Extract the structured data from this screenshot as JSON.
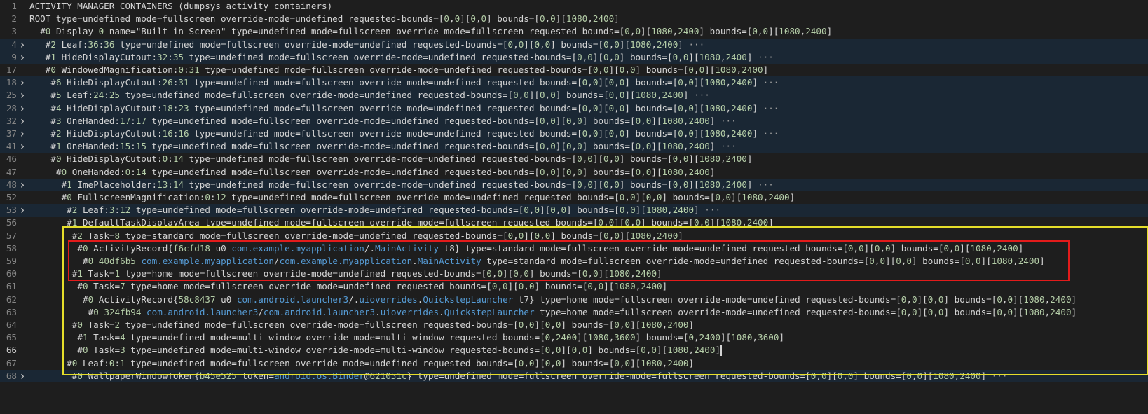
{
  "lines": [
    {
      "ln": "1",
      "fold": false,
      "indent": 0,
      "text": "ACTIVITY MANAGER CONTAINERS (dumpsys activity containers)"
    },
    {
      "ln": "2",
      "fold": false,
      "indent": 0,
      "text": "ROOT type=undefined mode=fullscreen override-mode=undefined requested-bounds=[0,0][0,0] bounds=[0,0][1080,2400]"
    },
    {
      "ln": "3",
      "fold": false,
      "indent": 2,
      "text": "#0 Display 0 name=\"Built-in Screen\" type=undefined mode=fullscreen override-mode=fullscreen requested-bounds=[0,0][1080,2400] bounds=[0,0][1080,2400]"
    },
    {
      "ln": "4",
      "fold": true,
      "indent": 3,
      "text": "#2 Leaf:36:36 type=undefined mode=fullscreen override-mode=undefined requested-bounds=[0,0][0,0] bounds=[0,0][1080,2400] ···"
    },
    {
      "ln": "9",
      "fold": true,
      "indent": 3,
      "text": "#1 HideDisplayCutout:32:35 type=undefined mode=fullscreen override-mode=undefined requested-bounds=[0,0][0,0] bounds=[0,0][1080,2400] ···"
    },
    {
      "ln": "17",
      "fold": false,
      "indent": 3,
      "text": "#0 WindowedMagnification:0:31 type=undefined mode=fullscreen override-mode=undefined requested-bounds=[0,0][0,0] bounds=[0,0][1080,2400]"
    },
    {
      "ln": "18",
      "fold": true,
      "indent": 4,
      "text": "#6 HideDisplayCutout:26:31 type=undefined mode=fullscreen override-mode=undefined requested-bounds=[0,0][0,0] bounds=[0,0][1080,2400] ···"
    },
    {
      "ln": "25",
      "fold": true,
      "indent": 4,
      "text": "#5 Leaf:24:25 type=undefined mode=fullscreen override-mode=undefined requested-bounds=[0,0][0,0] bounds=[0,0][1080,2400] ···"
    },
    {
      "ln": "28",
      "fold": true,
      "indent": 4,
      "text": "#4 HideDisplayCutout:18:23 type=undefined mode=fullscreen override-mode=undefined requested-bounds=[0,0][0,0] bounds=[0,0][1080,2400] ···"
    },
    {
      "ln": "32",
      "fold": true,
      "indent": 4,
      "text": "#3 OneHanded:17:17 type=undefined mode=fullscreen override-mode=undefined requested-bounds=[0,0][0,0] bounds=[0,0][1080,2400] ···"
    },
    {
      "ln": "37",
      "fold": true,
      "indent": 4,
      "text": "#2 HideDisplayCutout:16:16 type=undefined mode=fullscreen override-mode=undefined requested-bounds=[0,0][0,0] bounds=[0,0][1080,2400] ···"
    },
    {
      "ln": "41",
      "fold": true,
      "indent": 4,
      "text": "#1 OneHanded:15:15 type=undefined mode=fullscreen override-mode=undefined requested-bounds=[0,0][0,0] bounds=[0,0][1080,2400] ···"
    },
    {
      "ln": "46",
      "fold": false,
      "indent": 4,
      "text": "#0 HideDisplayCutout:0:14 type=undefined mode=fullscreen override-mode=undefined requested-bounds=[0,0][0,0] bounds=[0,0][1080,2400]"
    },
    {
      "ln": "47",
      "fold": false,
      "indent": 5,
      "text": "#0 OneHanded:0:14 type=undefined mode=fullscreen override-mode=undefined requested-bounds=[0,0][0,0] bounds=[0,0][1080,2400]"
    },
    {
      "ln": "48",
      "fold": true,
      "indent": 6,
      "text": "#1 ImePlaceholder:13:14 type=undefined mode=fullscreen override-mode=undefined requested-bounds=[0,0][0,0] bounds=[0,0][1080,2400] ···"
    },
    {
      "ln": "52",
      "fold": false,
      "indent": 6,
      "text": "#0 FullscreenMagnification:0:12 type=undefined mode=fullscreen override-mode=undefined requested-bounds=[0,0][0,0] bounds=[0,0][1080,2400]"
    },
    {
      "ln": "53",
      "fold": true,
      "indent": 7,
      "text": "#2 Leaf:3:12 type=undefined mode=fullscreen override-mode=undefined requested-bounds=[0,0][0,0] bounds=[0,0][1080,2400] ···"
    },
    {
      "ln": "56",
      "fold": false,
      "indent": 7,
      "text": "#1 DefaultTaskDisplayArea type=undefined mode=fullscreen override-mode=fullscreen requested-bounds=[0,0][0,0] bounds=[0,0][1080,2400]"
    },
    {
      "ln": "57",
      "fold": false,
      "indent": 8,
      "text": "#2 Task=8 type=standard mode=fullscreen override-mode=undefined requested-bounds=[0,0][0,0] bounds=[0,0][1080,2400]"
    },
    {
      "ln": "58",
      "fold": false,
      "indent": 9,
      "text": "#0 ActivityRecord{f6cfd18 u0 com.example.myapplication/.MainActivity t8} type=standard mode=fullscreen override-mode=undefined requested-bounds=[0,0][0,0] bounds=[0,0][1080,2400]"
    },
    {
      "ln": "59",
      "fold": false,
      "indent": 10,
      "text": "#0 40df6b5 com.example.myapplication/com.example.myapplication.MainActivity type=standard mode=fullscreen override-mode=undefined requested-bounds=[0,0][0,0] bounds=[0,0][1080,2400]"
    },
    {
      "ln": "60",
      "fold": false,
      "indent": 8,
      "text": "#1 Task=1 type=home mode=fullscreen override-mode=undefined requested-bounds=[0,0][0,0] bounds=[0,0][1080,2400]"
    },
    {
      "ln": "61",
      "fold": false,
      "indent": 9,
      "text": "#0 Task=7 type=home mode=fullscreen override-mode=undefined requested-bounds=[0,0][0,0] bounds=[0,0][1080,2400]"
    },
    {
      "ln": "62",
      "fold": false,
      "indent": 10,
      "text": "#0 ActivityRecord{58c8437 u0 com.android.launcher3/.uioverrides.QuickstepLauncher t7} type=home mode=fullscreen override-mode=undefined requested-bounds=[0,0][0,0] bounds=[0,0][1080,2400]"
    },
    {
      "ln": "63",
      "fold": false,
      "indent": 11,
      "text": "#0 324fb94 com.android.launcher3/com.android.launcher3.uioverrides.QuickstepLauncher type=home mode=fullscreen override-mode=undefined requested-bounds=[0,0][0,0] bounds=[0,0][1080,2400]"
    },
    {
      "ln": "64",
      "fold": false,
      "indent": 8,
      "text": "#0 Task=2 type=undefined mode=fullscreen override-mode=fullscreen requested-bounds=[0,0][0,0] bounds=[0,0][1080,2400]"
    },
    {
      "ln": "65",
      "fold": false,
      "indent": 9,
      "text": "#1 Task=4 type=undefined mode=multi-window override-mode=multi-window requested-bounds=[0,2400][1080,3600] bounds=[0,2400][1080,3600]"
    },
    {
      "ln": "66",
      "fold": false,
      "indent": 9,
      "text": "#0 Task=3 type=undefined mode=multi-window override-mode=multi-window requested-bounds=[0,0][0,0] bounds=[0,0][1080,2400]",
      "active": true
    },
    {
      "ln": "67",
      "fold": false,
      "indent": 7,
      "text": "#0 Leaf:0:1 type=undefined mode=fullscreen override-mode=undefined requested-bounds=[0,0][0,0] bounds=[0,0][1080,2400]"
    },
    {
      "ln": "68",
      "fold": true,
      "indent": 8,
      "text": "#0 WallpaperWindowToken{b45e525 token=android.os.Binder@621051c} type=undefined mode=fullscreen override-mode=fullscreen requested-bounds=[0,0][0,0] bounds=[0,0][1080,2400] ···"
    }
  ],
  "colors": {
    "background": "#1e1e1e",
    "number": "#b5cea8",
    "keyword": "#569cd6",
    "highlight_yellow": "#e5de2a",
    "highlight_red": "#e31b1b"
  },
  "icons": {
    "fold": "chevron-right-icon"
  }
}
